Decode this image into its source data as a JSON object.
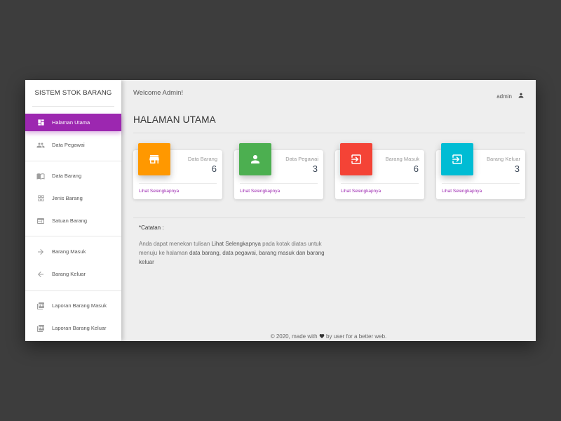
{
  "sidebar": {
    "title": "SISTEM STOK BARANG",
    "items": [
      {
        "label": "Halaman Utama"
      },
      {
        "label": "Data Pegawai"
      },
      {
        "label": "Data Barang"
      },
      {
        "label": "Jenis Barang"
      },
      {
        "label": "Satuan Barang"
      },
      {
        "label": "Barang Masuk"
      },
      {
        "label": "Barang Keluar"
      },
      {
        "label": "Laporan Barang Masuk"
      },
      {
        "label": "Laporan Barang Keluar"
      }
    ],
    "active_color": "#9c27b0"
  },
  "header": {
    "welcome": "Welcome Admin!",
    "username": "admin"
  },
  "page": {
    "title": "HALAMAN UTAMA"
  },
  "cards": [
    {
      "label": "Data Barang",
      "value": "6",
      "link": "Lihat Selengkapnya",
      "color": "#ff9800",
      "icon": "store-icon"
    },
    {
      "label": "Data Pegawai",
      "value": "3",
      "link": "Lihat Selengkapnya",
      "color": "#4caf50",
      "icon": "person-icon"
    },
    {
      "label": "Barang Masuk",
      "value": "6",
      "link": "Lihat Selengkapnya",
      "color": "#f44336",
      "icon": "login-icon"
    },
    {
      "label": "Barang Keluar",
      "value": "3",
      "link": "Lihat Selengkapnya",
      "color": "#00bcd4",
      "icon": "logout-icon"
    }
  ],
  "note": {
    "heading": "*Catatan :",
    "text_before": "Anda dapat menekan tulisan ",
    "highlight_link": "Lihat Selengkapnya",
    "text_middle": " pada kotak diatas untuk menuju ke halaman ",
    "highlight_pages": "data barang, data pegawai, barang masuk dan barang keluar"
  },
  "footer": {
    "before": "© 2020, made with",
    "after": "by user for a better web."
  }
}
